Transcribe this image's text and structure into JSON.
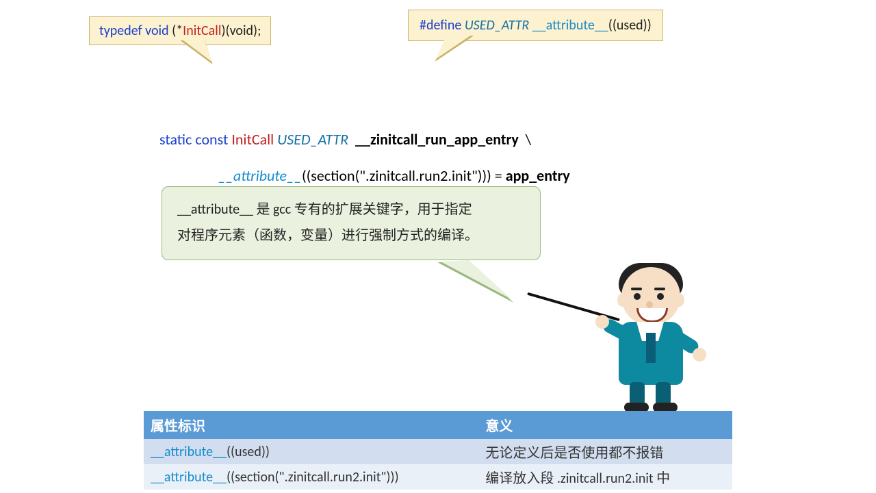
{
  "callout_left": {
    "p1": "typedef void",
    "p2": " (*",
    "p3": "InitCall",
    "p4": ")(void);"
  },
  "callout_right": {
    "p1": "#define ",
    "p2": "USED_ATTR",
    "p3": "   ",
    "p4": "__attribute__",
    "p5": "((used))"
  },
  "code": {
    "l1_a": "static const ",
    "l1_b": "InitCall ",
    "l1_c": "USED_ATTR ",
    "l1_d": " __zinitcall_run_app_entry",
    "l1_e": "  \\",
    "l2_a": "__attribute__",
    "l2_b": "((section(\".zinitcall.run2.init\"))) = ",
    "l2_c": "app_entry"
  },
  "speech": {
    "line1": "__attribute__ 是 gcc 专有的扩展关键字，用于指定",
    "line2": "对程序元素（函数，变量）进行强制方式的编译。"
  },
  "table": {
    "h1": "属性标识",
    "h2": "意义",
    "rows": [
      {
        "a_pre": "__attribute__",
        "a_post": "((used))",
        "b": "无论定义后是否使用都不报错"
      },
      {
        "a_pre": "__attribute__",
        "a_post": "((section(\".zinitcall.run2.init\")))",
        "b": "编译放入段 .zinitcall.run2.init 中"
      }
    ]
  }
}
